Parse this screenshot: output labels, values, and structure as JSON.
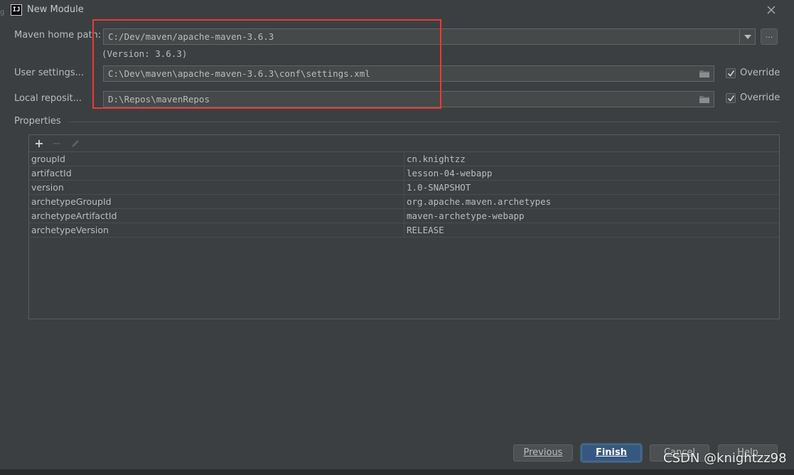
{
  "window": {
    "title": "New Module",
    "app_icon_text": "IJ"
  },
  "maven": {
    "home_path_label": "Maven home path:",
    "home_path_value": "C:/Dev/maven/apache-maven-3.6.3",
    "browse_label": "...",
    "version_text": "(Version: 3.6.3)",
    "user_settings_label": "User settings...",
    "user_settings_value": "C:\\Dev\\maven\\apache-maven-3.6.3\\conf\\settings.xml",
    "user_settings_override": {
      "label": "Override",
      "checked": true
    },
    "local_repo_label": "Local reposit...",
    "local_repo_value": "D:\\Repos\\mavenRepos",
    "local_repo_override": {
      "label": "Override",
      "checked": true
    }
  },
  "properties": {
    "title": "Properties",
    "rows": [
      {
        "key": "groupId",
        "value": "cn.knightzz"
      },
      {
        "key": "artifactId",
        "value": "lesson-04-webapp"
      },
      {
        "key": "version",
        "value": "1.0-SNAPSHOT"
      },
      {
        "key": "archetypeGroupId",
        "value": "org.apache.maven.archetypes"
      },
      {
        "key": "archetypeArtifactId",
        "value": "maven-archetype-webapp"
      },
      {
        "key": "archetypeVersion",
        "value": "RELEASE"
      }
    ]
  },
  "buttons": {
    "previous": "Previous",
    "finish": "Finish",
    "cancel": "Cancel",
    "help": "Help"
  },
  "watermark": "CSDN @knightzz98",
  "colors": {
    "highlight_box": "#e83b3b",
    "primary_button": "#365880"
  }
}
